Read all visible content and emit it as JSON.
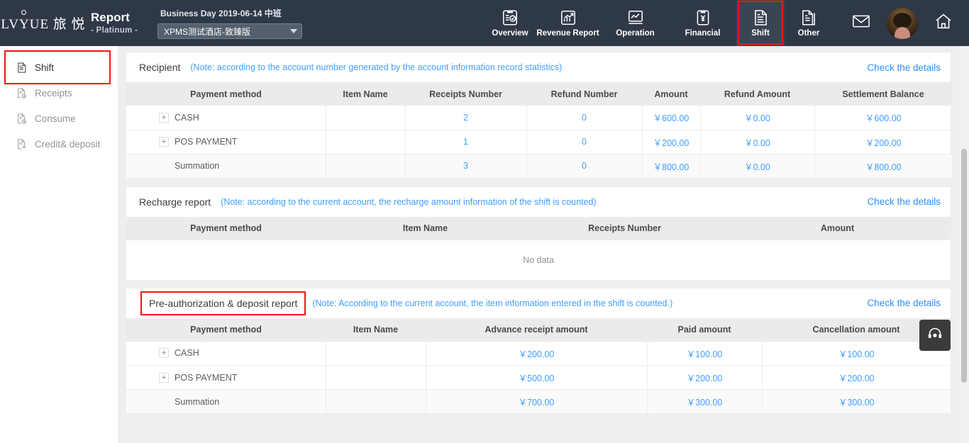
{
  "header": {
    "brand": "LVYUE 旅 悦",
    "report_title": "Report",
    "report_sub": "- Platinum -",
    "business_day": "Business Day 2019-06-14 中班",
    "hotel_selected": "XPMS测试酒店-致臻版",
    "nav": [
      {
        "label": "Overview",
        "icon": "clipboard-check-icon",
        "active": false
      },
      {
        "label": "Revenue Report",
        "icon": "chart-growth-icon",
        "active": false
      },
      {
        "label": "Operation",
        "icon": "line-chart-icon",
        "active": false
      },
      {
        "label": "Financial",
        "icon": "clipboard-yen-icon",
        "active": false
      },
      {
        "label": "Shift",
        "icon": "document-lines-icon",
        "active": true
      },
      {
        "label": "Other",
        "icon": "documents-stack-icon",
        "active": false
      }
    ],
    "mail_icon": "envelope-icon",
    "home_icon": "home-icon",
    "avatar": "user-avatar"
  },
  "sidebar": {
    "items": [
      {
        "label": "Shift",
        "icon": "document-icon",
        "active": true
      },
      {
        "label": "Receipts",
        "icon": "document-arrow-icon",
        "active": false
      },
      {
        "label": "Consume",
        "icon": "document-arrow-icon",
        "active": false
      },
      {
        "label": "Credit& deposit",
        "icon": "document-star-icon",
        "active": false
      }
    ]
  },
  "sections": [
    {
      "title": "Recipient",
      "note": "(Note: according to the account number generated by the account information record statistics)",
      "link": "Check the details",
      "columns": [
        "Payment method",
        "Item Name",
        "Receipts Number",
        "Refund Number",
        "Amount",
        "Refund Amount",
        "Settlement Balance"
      ],
      "rows": [
        {
          "expandable": true,
          "payment_method": "CASH",
          "item_name": "",
          "values": [
            "2",
            "0",
            "￥600.00",
            "￥0.00",
            "￥600.00"
          ]
        },
        {
          "expandable": true,
          "payment_method": "POS PAYMENT",
          "item_name": "",
          "values": [
            "1",
            "0",
            "￥200.00",
            "￥0.00",
            "￥200.00"
          ]
        },
        {
          "expandable": false,
          "payment_method": "Summation",
          "item_name": "",
          "values": [
            "3",
            "0",
            "￥800.00",
            "￥0.00",
            "￥800.00"
          ],
          "summary": true
        }
      ]
    },
    {
      "title": "Recharge report",
      "note": "(Note: according to the current account, the recharge amount information of the shift is counted)",
      "link": "Check the details",
      "columns": [
        "Payment method",
        "Item Name",
        "Receipts Number",
        "Amount"
      ],
      "rows": [],
      "empty_text": "No data"
    },
    {
      "title": "Pre-authorization & deposit report",
      "note": "(Note: According to the current account, the item information entered in the shift is counted.)",
      "link": "Check the details",
      "columns": [
        "Payment method",
        "Item Name",
        "Advance receipt amount",
        "Paid amount",
        "Cancellation amount"
      ],
      "rows": [
        {
          "expandable": true,
          "payment_method": "CASH",
          "item_name": "",
          "values": [
            "￥200.00",
            "￥100.00",
            "￥100.00"
          ]
        },
        {
          "expandable": true,
          "payment_method": "POS PAYMENT",
          "item_name": "",
          "values": [
            "￥500.00",
            "￥200.00",
            "￥200.00"
          ]
        },
        {
          "expandable": false,
          "payment_method": "Summation",
          "item_name": "",
          "values": [
            "￥700.00",
            "￥300.00",
            "￥300.00"
          ],
          "summary": true
        }
      ]
    }
  ],
  "support": {
    "icon": "headset-icon"
  },
  "expand_symbol": "+",
  "colors": {
    "topbar": "#2e3847",
    "accent_link": "#2f8ef4",
    "value_blue": "#409eff",
    "highlight_red": "#fb1414",
    "header_row": "#ebebeb"
  }
}
